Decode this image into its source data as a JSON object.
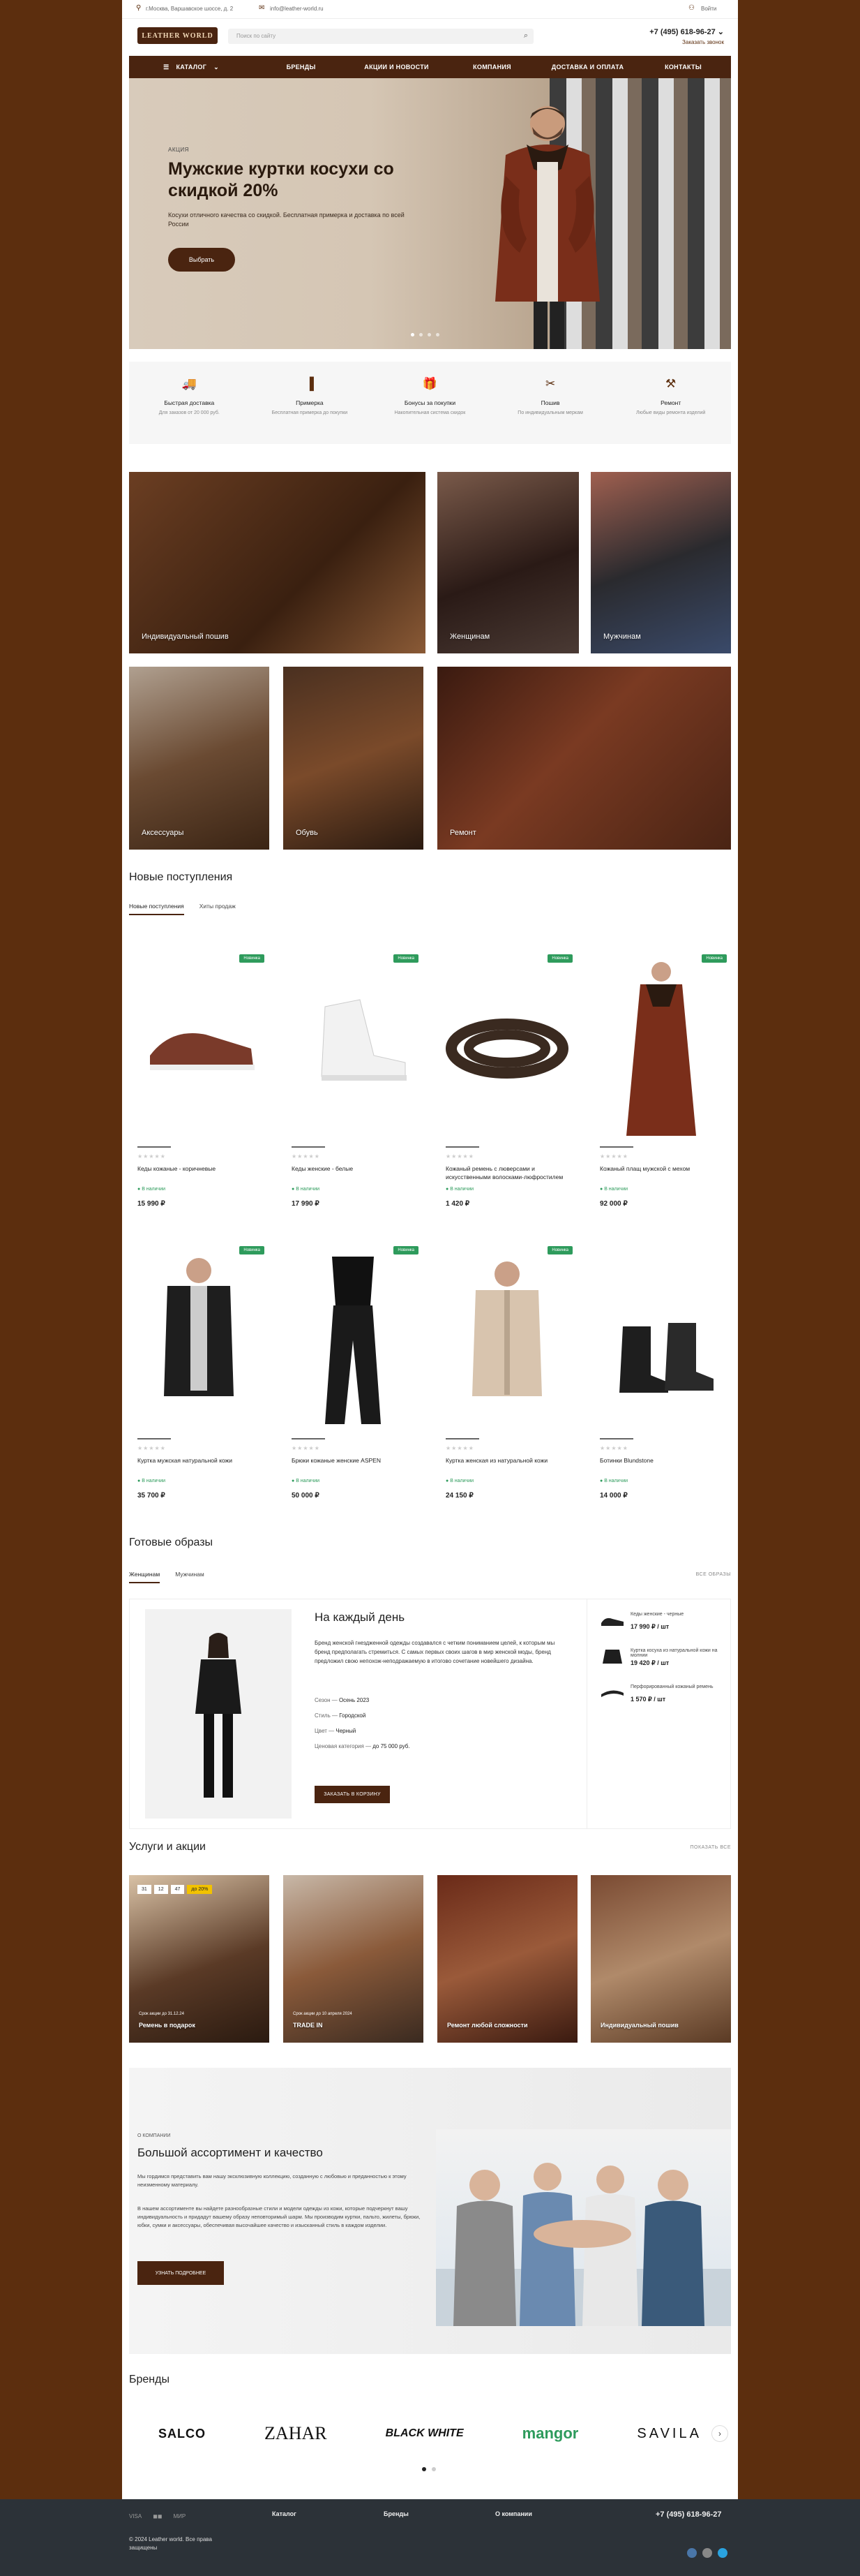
{
  "topbar": {
    "address": "г.Москва, Варшавское шоссе, д. 2",
    "email": "info@leather-world.ru",
    "login": "Войти"
  },
  "header": {
    "logo": "LEATHER WORLD",
    "search_placeholder": "Поиск по сайту",
    "phone": "+7 (495) 618-96-27",
    "callback": "Заказать звонок"
  },
  "nav": {
    "items": [
      "КАТАЛОГ",
      "БРЕНДЫ",
      "АКЦИИ И НОВОСТИ",
      "КОМПАНИЯ",
      "ДОСТАВКА И ОПЛАТА",
      "КОНТАКТЫ"
    ]
  },
  "hero": {
    "eyebrow": "АКЦИЯ",
    "title": "Мужские куртки косухи со скидкой 20%",
    "subtitle": "Косухи отличного качества со скидкой. Бесплатная примерка и доставка по всей России",
    "button": "Выбрать"
  },
  "features": [
    {
      "icon": "truck-icon",
      "glyph": "🚚",
      "title": "Быстрая доставка",
      "sub": "Для заказов от 20 000 руб."
    },
    {
      "icon": "hanger-icon",
      "glyph": "▐",
      "title": "Примерка",
      "sub": "Бесплатная примерка до покупки"
    },
    {
      "icon": "gift-icon",
      "glyph": "🎁",
      "title": "Бонусы за покупки",
      "sub": "Накопительная система скидок"
    },
    {
      "icon": "needle-icon",
      "glyph": "✂",
      "title": "Пошив",
      "sub": "По индивидуальным меркам"
    },
    {
      "icon": "repair-icon",
      "glyph": "⚒",
      "title": "Ремонт",
      "sub": "Любые виды ремонта изделий"
    }
  ],
  "categories": [
    "Индивидуальный пошив",
    "Женщинам",
    "Мужчинам",
    "Аксессуары",
    "Обувь",
    "Ремонт"
  ],
  "new_arrivals": {
    "title": "Новые поступления",
    "tabs": [
      "Новые поступления",
      "Хиты продаж"
    ],
    "products": [
      {
        "name": "Кеды кожаные - коричневые",
        "price": "15 990 ₽",
        "stock": "В наличии",
        "badge": "Новинка"
      },
      {
        "name": "Кеды женские - белые",
        "price": "17 990 ₽",
        "stock": "В наличии",
        "badge": "Новинка"
      },
      {
        "name": "Кожаный ремень с люверсами и искусственными волосками-люфростилем",
        "price": "1 420 ₽",
        "stock": "В наличии",
        "badge": "Новинка"
      },
      {
        "name": "Кожаный плащ мужской с мехом",
        "price": "92 000 ₽",
        "stock": "В наличии",
        "badge": "Новинка"
      },
      {
        "name": "Куртка мужская натуральной кожи",
        "price": "35 700 ₽",
        "stock": "В наличии",
        "badge": "Новинка"
      },
      {
        "name": "Брюки кожаные женские ASPEN",
        "price": "50 000 ₽",
        "stock": "В наличии",
        "badge": "Новинка"
      },
      {
        "name": "Куртка женская из натуральной кожи",
        "price": "24 150 ₽",
        "stock": "В наличии",
        "badge": "Новинка"
      },
      {
        "name": "Ботинки Blundstone",
        "price": "14 000 ₽",
        "stock": "В наличии",
        "badge": ""
      }
    ]
  },
  "looks": {
    "title": "Готовые образы",
    "tabs": [
      "Женщинам",
      "Мужчинам"
    ],
    "all": "ВСЕ ОБРАЗЫ",
    "card_title": "На каждый день",
    "desc": "Бренд женской гнездженной одежды создавался с четким пониманием целей, к которым мы бренд предполагать стремиться. С самых первых своих шагов в мир женской моды, бренд предложил свою непохож-неподражаемую в итогово сочетание новейшего дизайна.",
    "props": [
      {
        "k": "Сезон",
        "v": "Осень 2023"
      },
      {
        "k": "Стиль",
        "v": "Городской"
      },
      {
        "k": "Цвет",
        "v": "Черный"
      },
      {
        "k": "Ценовая категория",
        "v": "до 75 000 руб."
      }
    ],
    "button": "ЗАКАЗАТЬ В КОРЗИНУ",
    "items": [
      {
        "name": "Кеды женские - черные",
        "price": "17 990 ₽ / шт"
      },
      {
        "name": "Куртка косуха из натуральной кожи на молнии",
        "price": "19 420 ₽ / шт"
      },
      {
        "name": "Перфорированный кожаный ремень",
        "price": "1 570 ₽ / шт"
      }
    ]
  },
  "services": {
    "title": "Услуги и акции",
    "all": "ПОКАЗАТЬ ВСЕ",
    "countdown": [
      "31",
      "12",
      "47",
      "до 20%"
    ],
    "items": [
      {
        "title": "Ремень в подарок",
        "sub": "Срок акции до 31.12.24"
      },
      {
        "title": "TRADE IN",
        "sub": "Срок акции до 10 апреля 2024"
      },
      {
        "title": "Ремонт любой сложности",
        "sub": ""
      },
      {
        "title": "Индивидуальный пошив",
        "sub": ""
      }
    ]
  },
  "about": {
    "eyebrow": "О КОМПАНИИ",
    "title": "Большой ассортимент и качество",
    "p1": "Мы гордимся представить вам нашу эксклюзивную коллекцию, созданную с любовью и преданностью к этому неизменному материалу.",
    "p2": "В нашем ассортименте вы найдете разнообразные стили и модели одежды из кожи, которые подчеркнут вашу индивидуальность и придадут вашему образу неповторимый шарм. Мы производим куртки, пальто, жилеты, брюки, юбки, сумки и аксессуары, обеспечивая высочайшее качество и изысканный стиль в каждом изделии.",
    "button": "УЗНАТЬ ПОДРОБНЕЕ"
  },
  "brands": {
    "title": "Бренды",
    "items": [
      "SALCO",
      "ZAHAR",
      "BLACK WHITE",
      "mangor",
      "SAVILA"
    ]
  },
  "footer": {
    "payments": [
      "VISA",
      "◼◼",
      "МИР"
    ],
    "cols": [
      "Каталог",
      "Бренды",
      "О компании"
    ],
    "phone": "+7 (495) 618-96-27",
    "copy": "© 2024 Leather world. Все права защищены"
  }
}
